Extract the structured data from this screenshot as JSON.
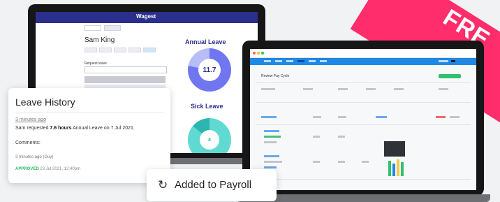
{
  "ribbon": {
    "text": "FRE"
  },
  "laptop_left": {
    "brand": "Wagest",
    "employee_name": "Sam King",
    "request_label": "Request leave",
    "annual_leave": {
      "title": "Annual Leave",
      "value": "11.7"
    },
    "sick_leave": {
      "title": "Sick Leave",
      "value": "4"
    }
  },
  "laptop_right": {
    "section_title": "Review Pay Cycle"
  },
  "leave_history": {
    "title": "Leave History",
    "time_ago": "3 minutes ago",
    "request_prefix": "Sam requested ",
    "request_hours": "7.6 hours",
    "request_suffix": " Annual Leave on 7 Jul 2021.",
    "comments_label": "Comments:",
    "comment_meta": "3 minutes ago (Guy)",
    "approved_label": "APPROVED",
    "approved_date": " 23 Jul 2021, 12:40pm"
  },
  "payroll_toast": {
    "icon": "sync-icon",
    "text": "Added to Payroll"
  },
  "colors": {
    "ribbon": "#ff2d6c",
    "brand_nav": "#2b2f8c",
    "payroll_nav": "#1e88e5",
    "approved": "#2fb86a"
  }
}
